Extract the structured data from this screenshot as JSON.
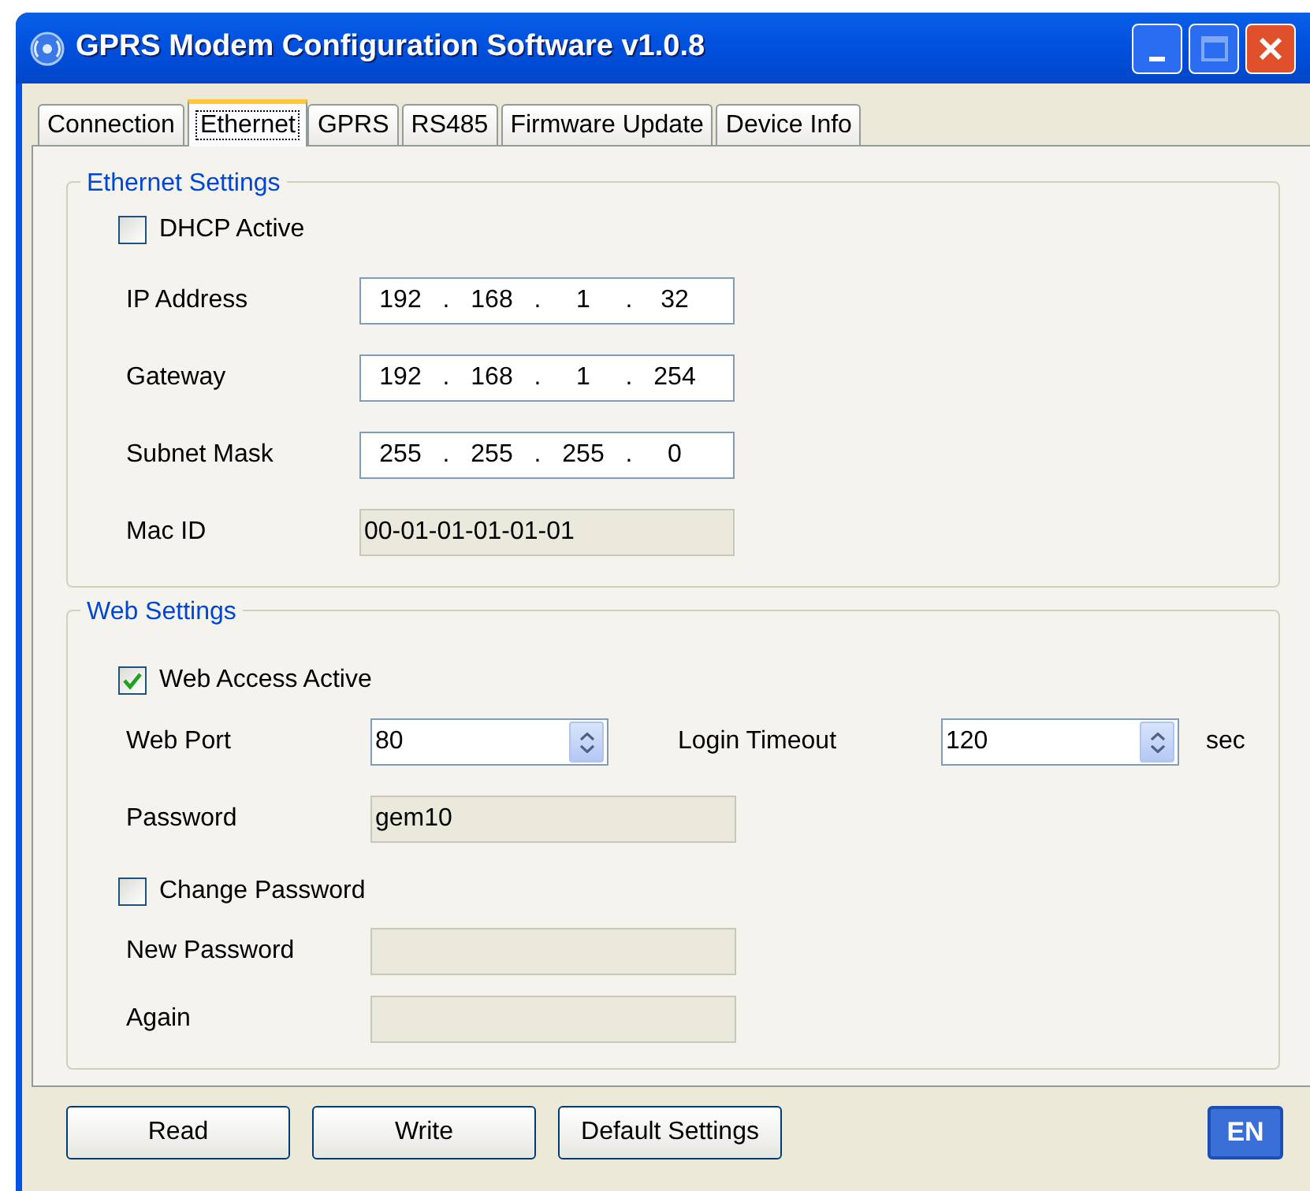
{
  "window": {
    "title": "GPRS Modem Configuration Software v1.0.8"
  },
  "tabs": [
    {
      "label": "Connection",
      "selected": false
    },
    {
      "label": "Ethernet",
      "selected": true
    },
    {
      "label": "GPRS",
      "selected": false
    },
    {
      "label": "RS485",
      "selected": false
    },
    {
      "label": "Firmware Update",
      "selected": false
    },
    {
      "label": "Device Info",
      "selected": false
    }
  ],
  "ethernet_settings": {
    "title": "Ethernet Settings",
    "dhcp": {
      "label": "DHCP Active",
      "checked": false
    },
    "fields": [
      {
        "label": "IP Address",
        "kind": "ip",
        "octets": [
          "192",
          "168",
          "1",
          "32"
        ],
        "separators": [
          ".",
          ".",
          "."
        ]
      },
      {
        "label": "Gateway",
        "kind": "ip",
        "octets": [
          "192",
          "168",
          "1",
          "254"
        ],
        "separators": [
          ".",
          ".",
          "."
        ]
      },
      {
        "label": "Subnet Mask",
        "kind": "ip",
        "octets": [
          "255",
          "255",
          "255",
          "0"
        ],
        "separators": [
          ".",
          ".",
          "."
        ]
      },
      {
        "label": "Mac ID",
        "kind": "readonly",
        "value": "00-01-01-01-01-01"
      }
    ]
  },
  "web_settings": {
    "title": "Web Settings",
    "web_access": {
      "label": "Web Access Active",
      "checked": true
    },
    "web_port": {
      "label": "Web Port",
      "value": "80"
    },
    "login_timeout": {
      "label": "Login Timeout",
      "value": "120",
      "unit": "sec"
    },
    "password": {
      "label": "Password",
      "value": "gem10"
    },
    "change_password": {
      "label": "Change Password",
      "checked": false
    },
    "new_password": {
      "label": "New Password"
    },
    "again": {
      "label": "Again"
    }
  },
  "buttons": [
    "Read",
    "Write",
    "Default Settings"
  ],
  "language": "EN"
}
